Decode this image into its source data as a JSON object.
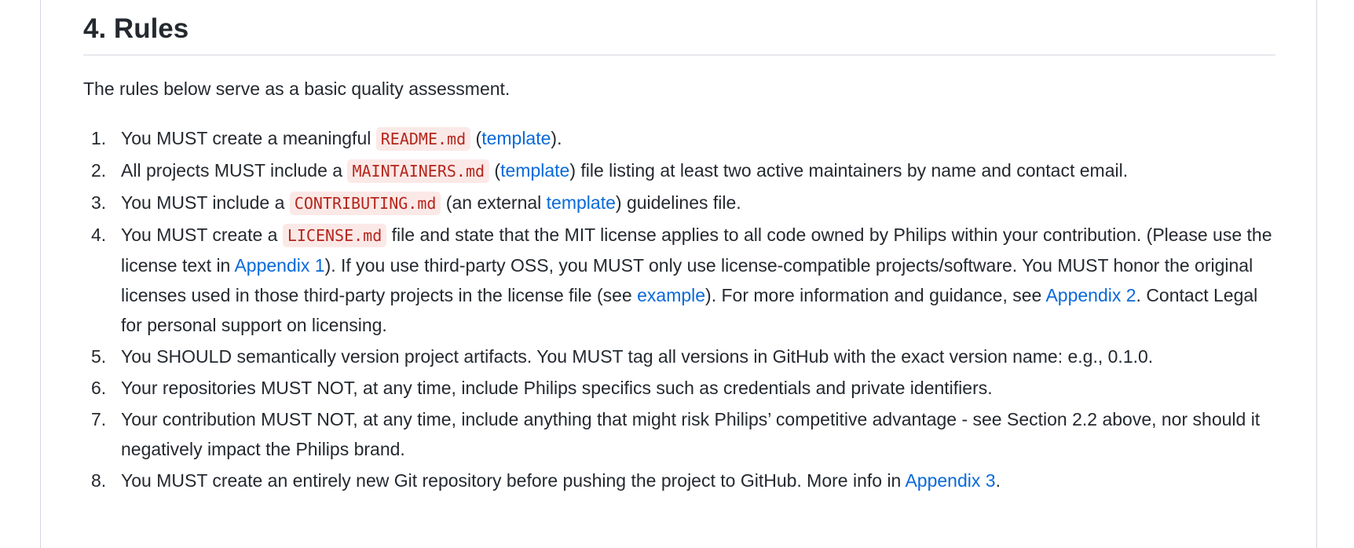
{
  "heading": "4. Rules",
  "intro": "The rules below serve as a basic quality assessment.",
  "rules": [
    {
      "num": "1.",
      "parts": [
        {
          "t": "text",
          "v": "You MUST create a meaningful "
        },
        {
          "t": "code",
          "v": "README.md"
        },
        {
          "t": "text",
          "v": " ("
        },
        {
          "t": "link",
          "v": "template"
        },
        {
          "t": "text",
          "v": ")."
        }
      ]
    },
    {
      "num": "2.",
      "parts": [
        {
          "t": "text",
          "v": "All projects MUST include a "
        },
        {
          "t": "code",
          "v": "MAINTAINERS.md"
        },
        {
          "t": "text",
          "v": " ("
        },
        {
          "t": "link",
          "v": "template"
        },
        {
          "t": "text",
          "v": ") file listing at least two active maintainers by name and contact email."
        }
      ]
    },
    {
      "num": "3.",
      "parts": [
        {
          "t": "text",
          "v": "You MUST include a "
        },
        {
          "t": "code",
          "v": "CONTRIBUTING.md"
        },
        {
          "t": "text",
          "v": " (an external "
        },
        {
          "t": "link",
          "v": "template"
        },
        {
          "t": "text",
          "v": ") guidelines file."
        }
      ]
    },
    {
      "num": "4.",
      "parts": [
        {
          "t": "text",
          "v": "You MUST create a "
        },
        {
          "t": "code",
          "v": "LICENSE.md"
        },
        {
          "t": "text",
          "v": " file and state that the MIT license applies to all code owned by Philips within your contribution. (Please use the license text in "
        },
        {
          "t": "link",
          "v": "Appendix 1"
        },
        {
          "t": "text",
          "v": "). If you use third-party OSS, you MUST only use license-compatible projects/software. You MUST honor the original licenses used in those third-party projects in the license file (see "
        },
        {
          "t": "link",
          "v": "example"
        },
        {
          "t": "text",
          "v": "). For more information and guidance, see "
        },
        {
          "t": "link",
          "v": "Appendix 2"
        },
        {
          "t": "text",
          "v": ". Contact Legal for personal support on licensing."
        }
      ]
    },
    {
      "num": "5.",
      "parts": [
        {
          "t": "text",
          "v": "You SHOULD semantically version project artifacts. You MUST tag all versions in GitHub with the exact version name: e.g., 0.1.0."
        }
      ]
    },
    {
      "num": "6.",
      "parts": [
        {
          "t": "text",
          "v": "Your repositories MUST NOT, at any time, include Philips specifics such as credentials and private identifiers."
        }
      ]
    },
    {
      "num": "7.",
      "parts": [
        {
          "t": "text",
          "v": "Your contribution MUST NOT, at any time, include anything that might risk Philips’ competitive advantage - see Section 2.2 above, nor should it negatively impact the Philips brand."
        }
      ]
    },
    {
      "num": "8.",
      "parts": [
        {
          "t": "text",
          "v": "You MUST create an entirely new Git repository before pushing the project to GitHub. More info in "
        },
        {
          "t": "link",
          "v": "Appendix 3"
        },
        {
          "t": "text",
          "v": "."
        }
      ]
    }
  ]
}
